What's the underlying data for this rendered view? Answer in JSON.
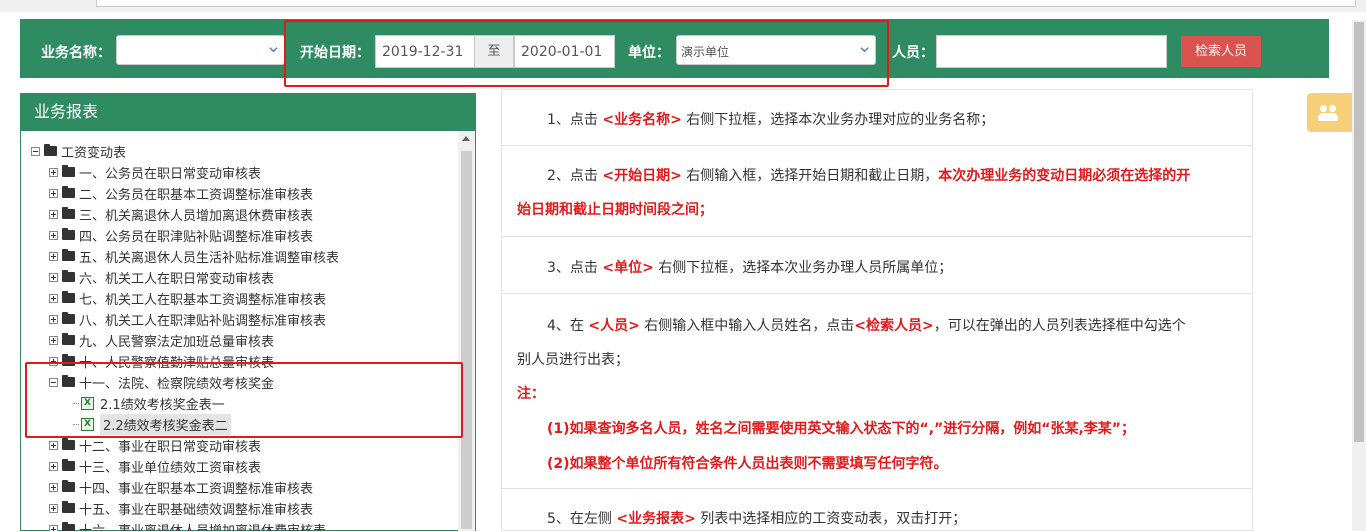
{
  "toolbar": {
    "business_label": "业务名称：",
    "business_value": "",
    "start_date_label": "开始日期：",
    "start_date_value": "2019-12-31",
    "to_label": "至",
    "end_date_value": "2020-01-01",
    "unit_label": "单位：",
    "unit_value": "演示单位",
    "person_label": "人员：",
    "person_value": "",
    "search_button": "检索人员"
  },
  "sidebar": {
    "title": "业务报表",
    "root": "工资变动表",
    "items": [
      "一、公务员在职日常变动审核表",
      "二、公务员在职基本工资调整标准审核表",
      "三、机关离退休人员增加离退休费审核表",
      "四、公务员在职津贴补贴调整标准审核表",
      "五、机关离退休人员生活补贴标准调整审核表",
      "六、机关工人在职日常变动审核表",
      "七、机关工人在职基本工资调整标准审核表",
      "八、机关工人在职津贴补贴调整标准审核表",
      "九、人民警察法定加班总量审核表",
      "十、人民警察值勤津贴总量审核表",
      "十一、法院、检察院绩效考核奖金",
      "十二、事业在职日常变动审核表",
      "十三、事业单位绩效工资审核表",
      "十四、事业在职基本工资调整标准审核表",
      "十五、事业在职基础绩效调整标准审核表",
      "十六、事业离退休人员增加离退休费审核表"
    ],
    "leaves": [
      "2.1绩效考核奖金表一",
      "2.2绩效考核奖金表二"
    ]
  },
  "instructions": {
    "s1": {
      "a": "1、点击 ",
      "b": "<业务名称>",
      "c": " 右侧下拉框，选择本次业务办理对应的业务名称；"
    },
    "s2": {
      "a": "2、点击 ",
      "b": "<开始日期>",
      "c": " 右侧输入框，选择开始日期和截止日期，",
      "d": "本次办理业务的变动日期必须在选择的开",
      "e": "始日期和截止日期时间段之间；"
    },
    "s3": {
      "a": "3、点击 ",
      "b": "<单位>",
      "c": " 右侧下拉框，选择本次业务办理人员所属单位；"
    },
    "s4": {
      "a": "4、在 ",
      "b": "<人员>",
      "c": " 右侧输入框中输入人员姓名，点击",
      "d": "<检索人员>",
      "e": "，可以在弹出的人员列表选择框中勾选个",
      "f": "别人员进行出表；",
      "note": "注：",
      "n1": "(1)如果查询多名人员，姓名之间需要使用英文输入状态下的“,”进行分隔，例如“张某,李某”；",
      "n2": "(2)如果整个单位所有符合条件人员出表则不需要填写任何字符。"
    },
    "s5": {
      "a": "5、在左侧 ",
      "b": "<业务报表>",
      "c": " 列表中选择相应的工资变动表，双击打开；"
    }
  }
}
